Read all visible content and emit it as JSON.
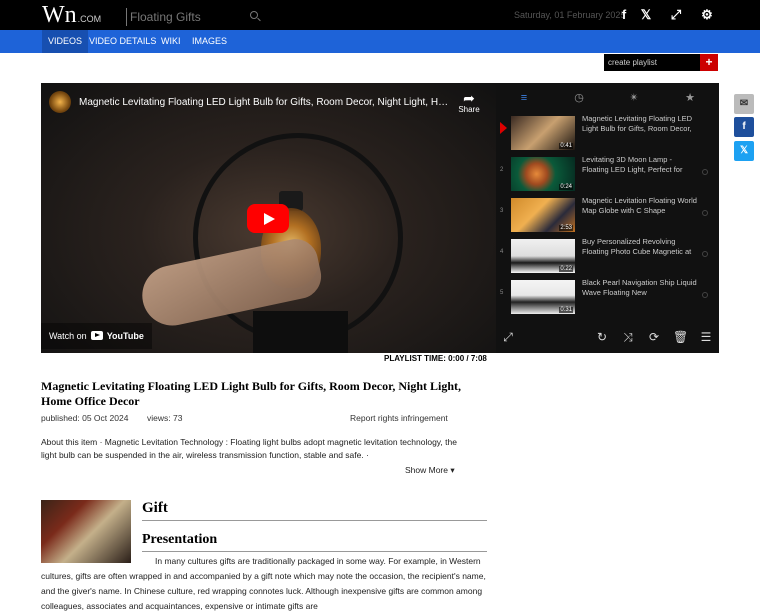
{
  "header": {
    "logo_main": "Wn",
    "logo_suffix": ".COM",
    "search_placeholder": "Floating Gifts",
    "date": "Saturday, 01 February 2025",
    "icons": [
      "facebook-icon",
      "twitter-icon",
      "fullscreen-icon",
      "gear-icon"
    ]
  },
  "nav": {
    "items": [
      "VIDEOS",
      "VIDEO DETAILS",
      "WIKI",
      "IMAGES"
    ],
    "active": "VIDEOS"
  },
  "playlist_button": "create playlist",
  "playlist_add": "+",
  "side_share": [
    "email-icon",
    "facebook-icon",
    "twitter-icon"
  ],
  "player": {
    "title": "Magnetic Levitating Floating LED Light Bulb for Gifts, Room Decor, Night Light, Home Office Decor",
    "share_label": "Share",
    "watch_on": "Watch on",
    "youtube": "YouTube"
  },
  "panel_tabs": [
    "playlist-icon",
    "clock-icon",
    "fire-icon",
    "star-icon"
  ],
  "playlist": [
    {
      "num": "",
      "title": "Magnetic Levitating Floating LED Light Bulb for Gifts, Room Decor,",
      "duration": "0:41"
    },
    {
      "num": "2",
      "title": "Levitating 3D Moon Lamp - Floating LED Light, Perfect for",
      "duration": "0:24"
    },
    {
      "num": "3",
      "title": "Magnetic Levitation Floating World Map Globe with C Shape",
      "duration": "2:53"
    },
    {
      "num": "4",
      "title": "Buy Personalized Revolving Floating Photo Cube Magnetic at",
      "duration": "0:22"
    },
    {
      "num": "5",
      "title": "Black Pearl Navigation Ship Liquid Wave Floating New",
      "duration": "0:31"
    }
  ],
  "panel_controls": [
    "expand-icon",
    "repeat-icon",
    "shuffle-icon",
    "loop-icon",
    "trash-icon",
    "list-icon"
  ],
  "playlist_time": "PLAYLIST TIME: 0:00 / 7:08",
  "video": {
    "title": "Magnetic Levitating Floating LED Light Bulb for Gifts, Room Decor, Night Light, Home Office Decor",
    "published": "published: 05 Oct 2024",
    "views": "views: 73",
    "report": "Report rights infringement",
    "description": "About this item · Magnetic Levitation Technology : Floating light bulbs adopt magnetic levitation technology, the light bulb can be suspended in the air, wireless transmission function, stable and safe. ·",
    "show_more": "Show More"
  },
  "wiki": {
    "heading": "Gift",
    "subheading": "Presentation",
    "text": "In many cultures gifts are traditionally packaged in some way. For example, in Western cultures, gifts are often wrapped in and accompanied by a gift note which may note the occasion, the recipient's name, and the giver's name. In Chinese culture, red wrapping connotes luck. Although inexpensive gifts are common among colleagues, associates and acquaintances, expensive or intimate gifts are"
  }
}
